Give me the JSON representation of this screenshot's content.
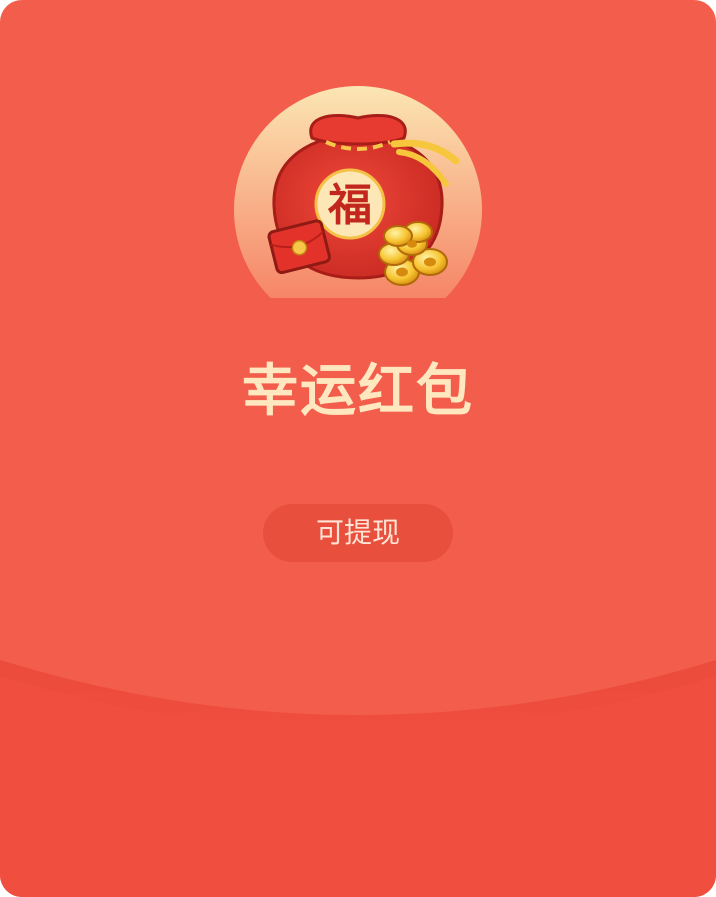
{
  "envelope": {
    "title": "幸运红包",
    "withdraw_label": "可提现",
    "emblem_character": "福"
  },
  "colors": {
    "card_background": "#f35e4c",
    "flap_background": "#f04e3e",
    "title_color": "#ffe8c0",
    "button_background": "#e84f3d",
    "button_text": "#ffe3d4"
  },
  "icons": {
    "emblem": "lucky-bag-icon",
    "coins": "coin-stack-icon",
    "small_envelope": "red-envelope-icon"
  }
}
